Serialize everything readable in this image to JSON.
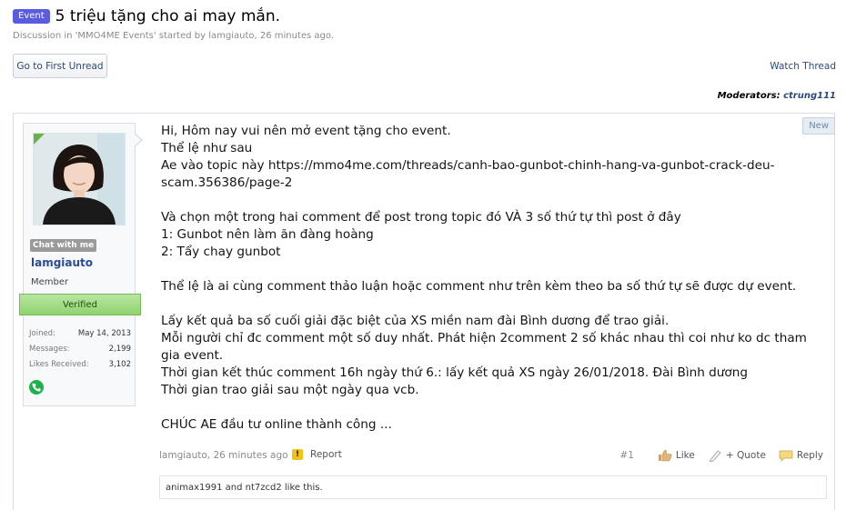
{
  "thread": {
    "badge": "Event",
    "title": "5 triệu tặng cho ai may mắn.",
    "subtitle": "Discussion in 'MMO4ME Events' started by lamgiauto, 26 minutes ago."
  },
  "actions": {
    "first_unread": "Go to First Unread",
    "watch_thread": "Watch Thread"
  },
  "moderators": {
    "label": "Moderators:",
    "name": "ctrung111"
  },
  "post": {
    "new_tag": "New",
    "user": {
      "chat_badge": "Chat with me",
      "username": "lamgiauto",
      "title": "Member",
      "verified": "Verified",
      "stats": [
        {
          "label": "Joined:",
          "value": "May 14, 2013"
        },
        {
          "label": "Messages:",
          "value": "2,199"
        },
        {
          "label": "Likes Received:",
          "value": "3,102"
        }
      ]
    },
    "lines": [
      "Hi, Hôm nay vui nên mở event tặng cho event.",
      "Thể lệ như sau",
      "Ae vào topic này https://mmo4me.com/threads/canh-bao-gunbot-chinh-hang-va-gunbot-crack-deu-",
      "scam.356386/page-2",
      "",
      "Và chọn một trong hai comment để post trong topic đó VÀ 3 số thứ tự thì post ở đây",
      "1: Gunbot nên làm ăn đàng hoàng",
      "2: Tẩy chay gunbot",
      "",
      "Thể lệ là ai cùng comment thảo luận hoặc comment như trên kèm theo ba số thứ tự sẽ được dự event.",
      "",
      "Lấy kết quả ba số cuối giải đặc biệt của XS miền nam đài Bình dương để trao giải.",
      "Mỗi người chỉ đc comment một số duy nhất. Phát hiện 2comment 2 số khác nhau thì coi như ko dc tham",
      "gia event.",
      "Thời gian kết thúc comment 16h ngày thứ 6.: lấy kết quả XS ngày 26/01/2018. Đài Bình dương",
      "Thời gian trao giải sau một ngày qua vcb.",
      "",
      "CHÚC AE đầu tư online thành công ..."
    ],
    "footer": {
      "author_date": "lamgiauto, 26 minutes ago",
      "report": "Report",
      "post_num": "#1",
      "like": "Like",
      "quote": "+ Quote",
      "reply": "Reply"
    },
    "likes_text": "animax1991 and nt7zcd2 like this."
  }
}
